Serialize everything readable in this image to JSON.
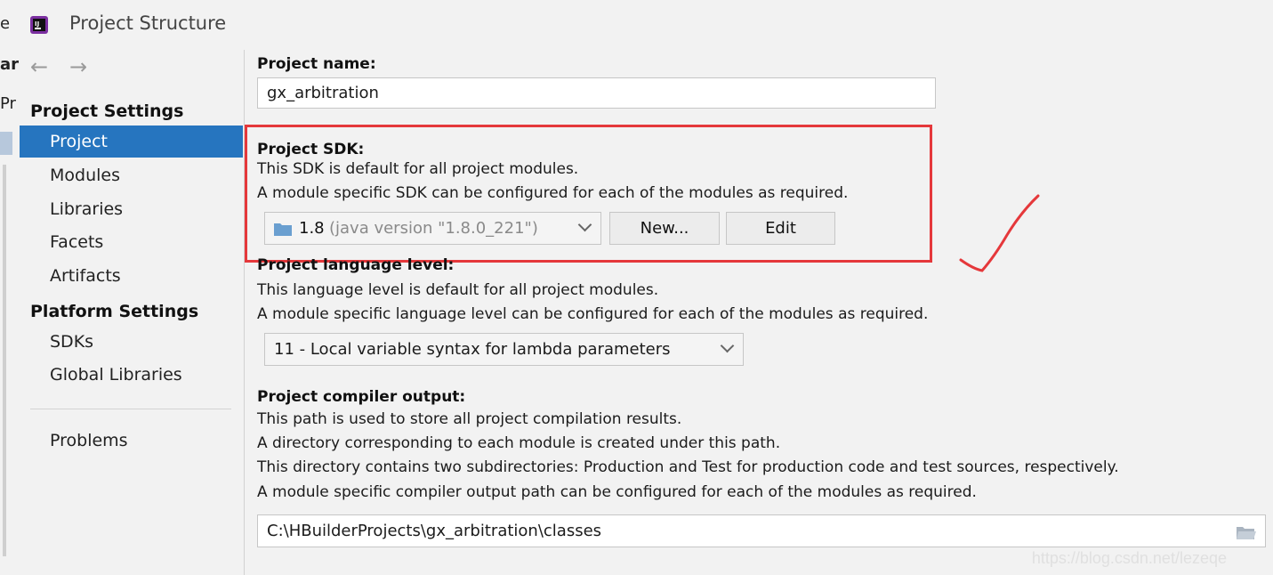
{
  "window": {
    "title": "Project Structure"
  },
  "left_strip": {
    "chars": [
      "e",
      "ar",
      "Pr"
    ]
  },
  "sidebar": {
    "project_settings_heading": "Project Settings",
    "project_items": [
      {
        "label": "Project",
        "selected": true
      },
      {
        "label": "Modules"
      },
      {
        "label": "Libraries"
      },
      {
        "label": "Facets"
      },
      {
        "label": "Artifacts"
      }
    ],
    "platform_settings_heading": "Platform Settings",
    "platform_items": [
      {
        "label": "SDKs"
      },
      {
        "label": "Global Libraries"
      }
    ],
    "problems_label": "Problems"
  },
  "main": {
    "project_name": {
      "label": "Project name:",
      "value": "gx_arbitration"
    },
    "project_sdk": {
      "label": "Project SDK:",
      "desc1": "This SDK is default for all project modules.",
      "desc2": "A module specific SDK can be configured for each of the modules as required.",
      "sdk_version": "1.8",
      "sdk_detail": "(java version \"1.8.0_221\")",
      "new_button": "New...",
      "edit_button": "Edit"
    },
    "language_level": {
      "label": "Project language level:",
      "desc1": "This language level is default for all project modules.",
      "desc2": "A module specific language level can be configured for each of the modules as required.",
      "value": "11 - Local variable syntax for lambda parameters"
    },
    "compiler_output": {
      "label": "Project compiler output:",
      "desc1": "This path is used to store all project compilation results.",
      "desc2": "A directory corresponding to each module is created under this path.",
      "desc3": "This directory contains two subdirectories: Production and Test for production code and test sources, respectively.",
      "desc4": "A module specific compiler output path can be configured for each of the modules as required.",
      "path": "C:\\HBuilderProjects\\gx_arbitration\\classes"
    }
  },
  "watermark": "https://blog.csdn.net/lezeqe",
  "colors": {
    "selection": "#2675bf",
    "annotation": "#e5383b",
    "folder_icon": "#6a9fd0"
  },
  "icons": [
    "intellij-app-icon",
    "back-arrow-icon",
    "forward-arrow-icon",
    "folder-icon",
    "chevron-down-icon",
    "checkmark-annotation-icon"
  ]
}
